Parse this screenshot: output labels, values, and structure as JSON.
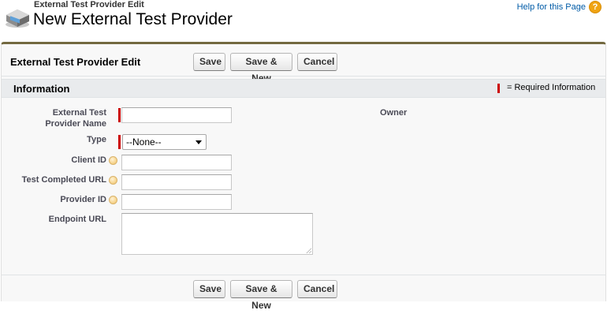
{
  "header": {
    "breadcrumb": "External Test Provider Edit",
    "title": "New External Test Provider",
    "help_link": "Help for this Page",
    "help_icon": "?"
  },
  "top_bar": {
    "title": "External Test Provider Edit",
    "save_label": "Save",
    "save_new_label": "Save & New",
    "cancel_label": "Cancel"
  },
  "section": {
    "title": "Information",
    "required_legend": "= Required Information"
  },
  "fields": {
    "name_label": "External Test Provider Name",
    "name_value": "",
    "type_label": "Type",
    "type_selected": "--None--",
    "client_id_label": "Client ID",
    "client_id_value": "",
    "test_completed_url_label": "Test Completed URL",
    "test_completed_url_value": "",
    "provider_id_label": "Provider ID",
    "provider_id_value": "",
    "endpoint_url_label": "Endpoint URL",
    "endpoint_url_value": "",
    "owner_label": "Owner"
  },
  "bottom_bar": {
    "save_label": "Save",
    "save_new_label": "Save & New",
    "cancel_label": "Cancel"
  },
  "colors": {
    "accent_border": "#736940",
    "required": "#cc0000",
    "link": "#015ba7",
    "help_icon": "#f0a412"
  }
}
